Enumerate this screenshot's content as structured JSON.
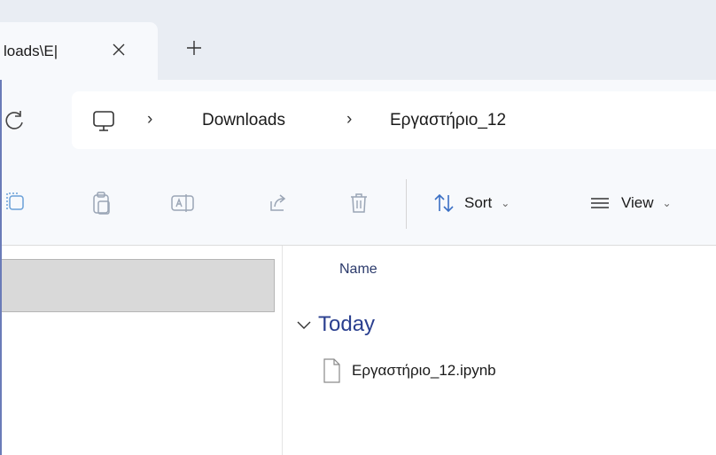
{
  "tabs": [
    {
      "title": "loads\\Ε|",
      "active": true
    }
  ],
  "address": {
    "crumbs": [
      "Downloads",
      "Εργαστήριο_12"
    ]
  },
  "toolbar": {
    "icons": [
      "copy-icon",
      "paste-icon",
      "rename-icon",
      "share-icon",
      "delete-icon"
    ],
    "sort_label": "Sort",
    "view_label": "View"
  },
  "columns": {
    "name": "Name"
  },
  "groups": [
    {
      "label": "Today",
      "files": [
        {
          "name": "Εργαστήριο_12.ipynb",
          "icon": "file-icon"
        }
      ]
    }
  ],
  "colors": {
    "accent": "#2a3f8f",
    "chrome": "#e9edf3",
    "panel": "#f7f9fc",
    "selection": "#d9d9d9"
  }
}
